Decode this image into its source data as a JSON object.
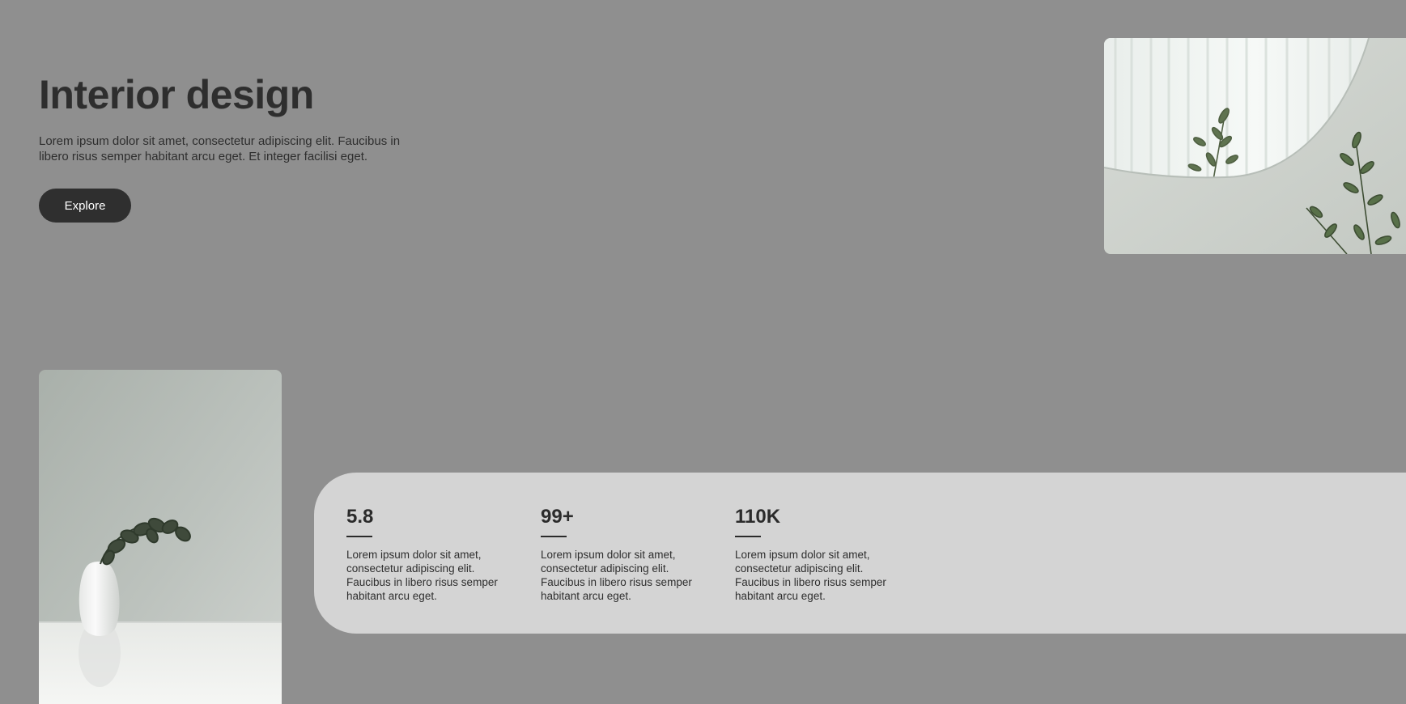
{
  "hero": {
    "title": "Interior design",
    "text": "Lorem ipsum dolor sit amet, consectetur adipiscing elit. Faucibus in libero risus semper habitant arcu eget. Et integer facilisi eget.",
    "button_label": "Explore"
  },
  "stats": [
    {
      "value": "5.8",
      "text": "Lorem ipsum dolor sit amet, consectetur adipiscing elit. Faucibus in libero risus semper habitant arcu eget."
    },
    {
      "value": "99+",
      "text": "Lorem ipsum dolor sit amet, consectetur adipiscing elit. Faucibus in libero risus semper habitant arcu eget."
    },
    {
      "value": "110K",
      "text": "Lorem ipsum dolor sit amet, consectetur adipiscing elit. Faucibus in libero risus semper habitant arcu eget."
    }
  ],
  "colors": {
    "background": "#8f8f8f",
    "panel": "#d4d4d4",
    "button": "#2f2f2f",
    "text": "#2b2b2b"
  }
}
